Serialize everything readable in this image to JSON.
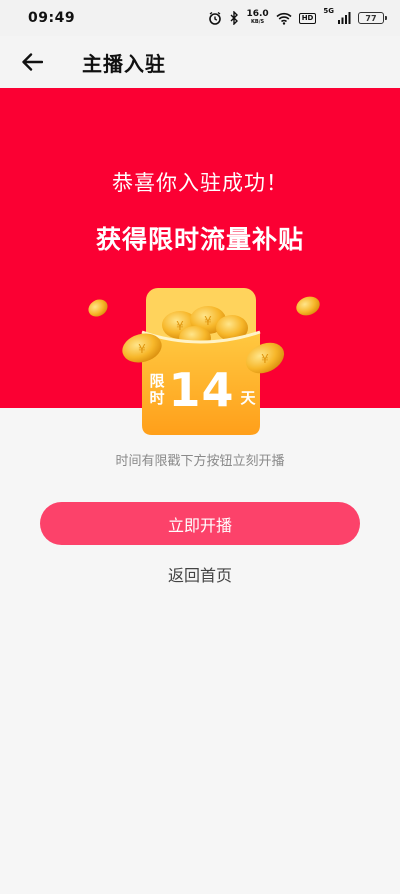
{
  "status_bar": {
    "time": "09:49",
    "speed_value": "16.0",
    "speed_unit": "KB/S",
    "hd": "HD",
    "network": "5G",
    "battery": "77"
  },
  "app_bar": {
    "title": "主播入驻"
  },
  "hero": {
    "line1": "恭喜你入驻成功！",
    "line2": "获得限时流量补贴",
    "background_color": "#fb0033"
  },
  "envelope": {
    "label_top": "限",
    "label_bottom": "时",
    "number": "14",
    "unit": "天"
  },
  "main": {
    "hint": "时间有限戳下方按钮立刻开播",
    "primary_button": "立即开播",
    "secondary_link": "返回首页",
    "accent_color": "#fc426a"
  }
}
